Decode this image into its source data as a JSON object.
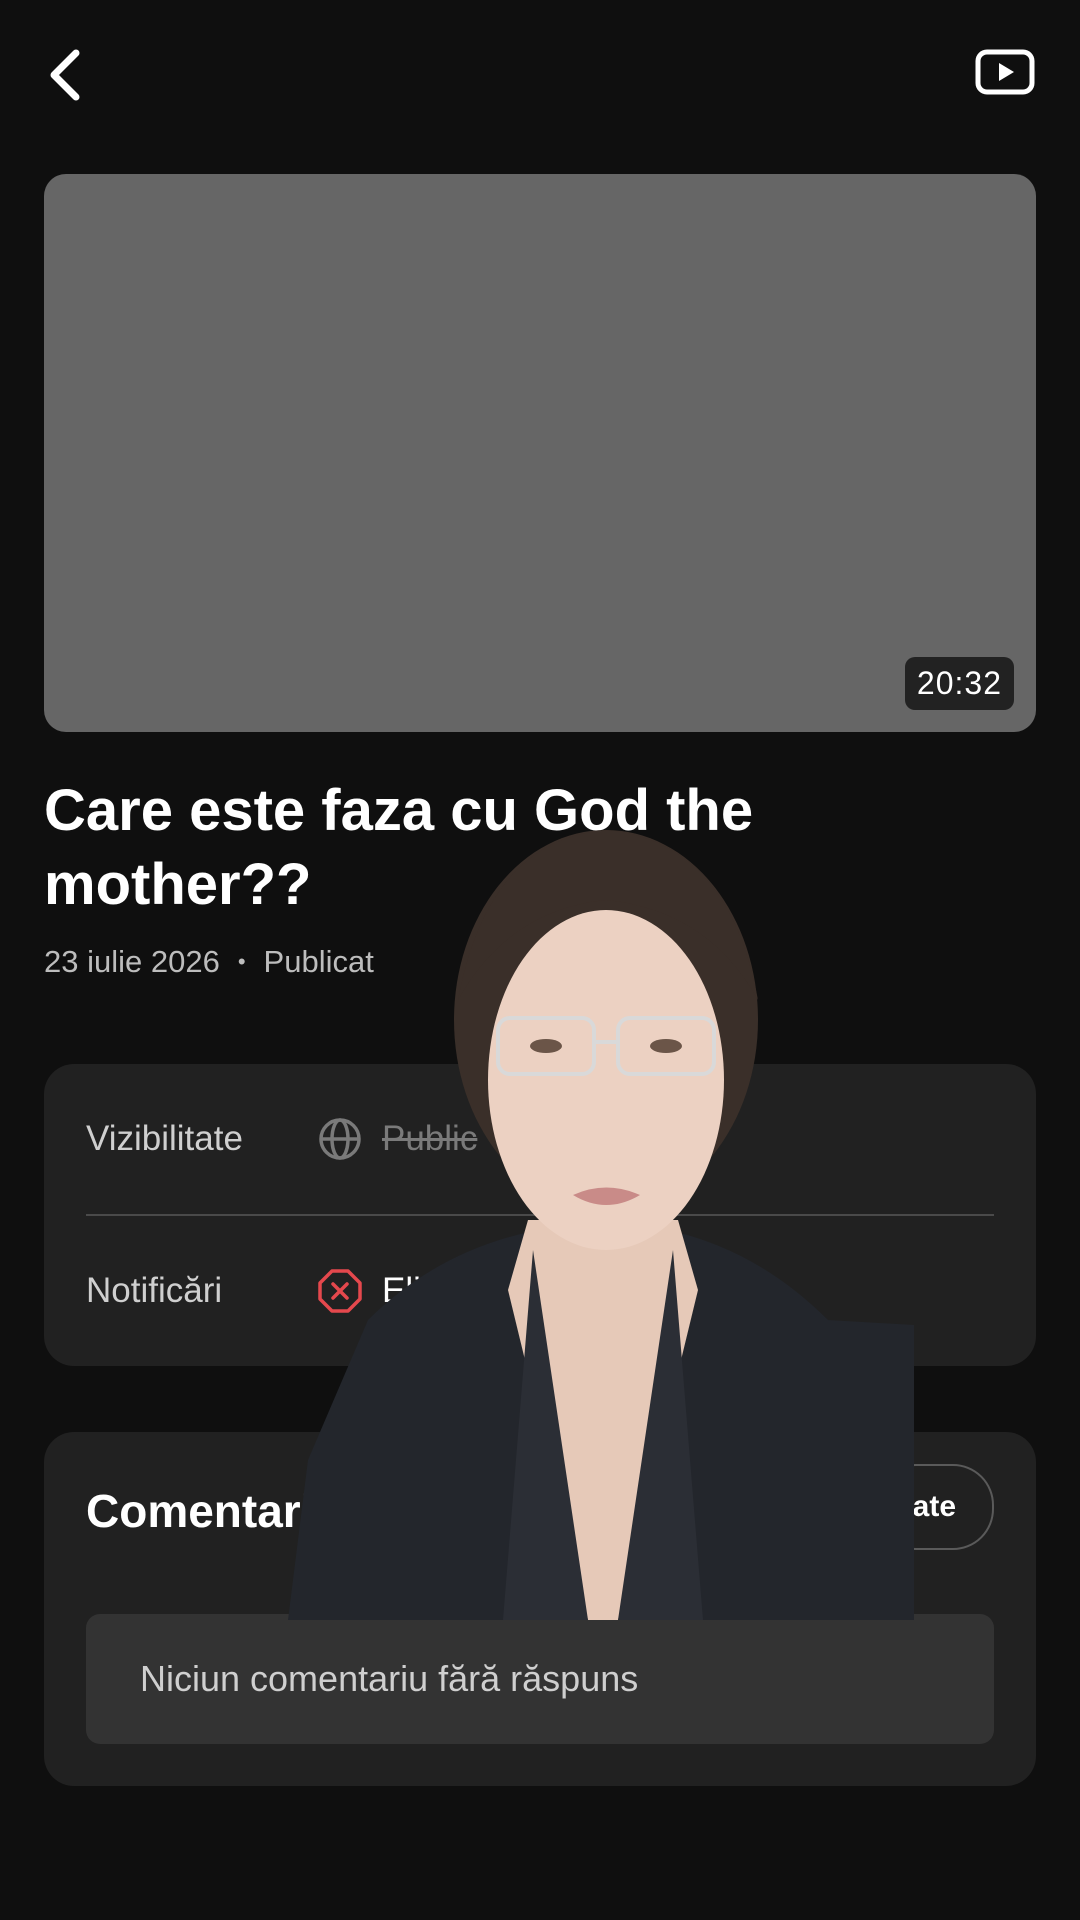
{
  "header": {
    "back_icon": "chevron-left-icon",
    "youtube_icon": "youtube-play-icon"
  },
  "video": {
    "duration": "20:32",
    "title": "Care este faza cu God the mother??",
    "date": "23 iulie 2026",
    "status": "Publicat"
  },
  "settings": {
    "visibility_label": "Vizibilitate",
    "visibility_value": "Public",
    "visibility_icon": "globe-icon",
    "notifications_label": "Notificări",
    "notifications_value": "Elimin",
    "notifications_icon": "x-circle-icon",
    "notifications_icon_color": "#e5484d"
  },
  "comments": {
    "title": "Comentarii",
    "action_label": "ate",
    "empty_text": "Niciun comentariu fără răspuns"
  },
  "colors": {
    "background": "#0f0f0f",
    "thumbnail": "#666666",
    "card": "#212121"
  }
}
